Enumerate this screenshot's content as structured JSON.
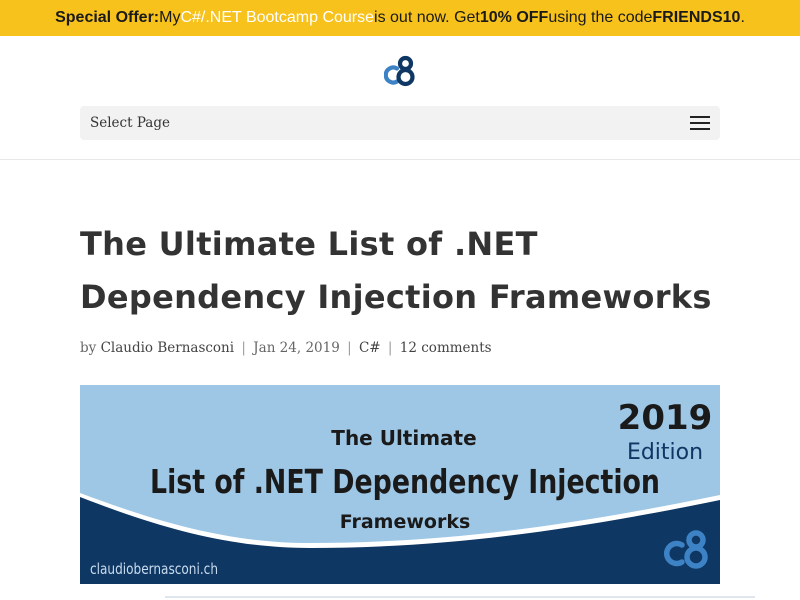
{
  "promo": {
    "prefix": "Special Offer:",
    "text1": " My ",
    "course_link": "C#/.NET Bootcamp Course",
    "text2": " is out now. Get ",
    "discount": "10% OFF",
    "text3": " using the code ",
    "code": "FRIENDS10",
    "text4": "."
  },
  "nav": {
    "select_label": "Select Page",
    "menu_icon": "hamburger-icon"
  },
  "logo": {
    "icon": "c8-logo"
  },
  "post": {
    "title": "The Ultimate List of .NET Dependency Injection Frameworks",
    "by": "by ",
    "author": "Claudio Bernasconi",
    "sep": "|",
    "date": "Jan 24, 2019",
    "category": "C#",
    "comments": "12 comments"
  },
  "featured_image": {
    "year": "2019",
    "edition": "Edition",
    "line1": "The Ultimate",
    "line2": "List of .NET Dependency Injection",
    "line3": "Frameworks",
    "site": "claudiobernasconi.ch",
    "colors": {
      "light": "#9ec7e6",
      "dark": "#0e3763",
      "mid": "#3d82c4"
    }
  },
  "colors": {
    "promo_bg": "#f7c21b",
    "menu_bg": "#f2f2f2"
  }
}
